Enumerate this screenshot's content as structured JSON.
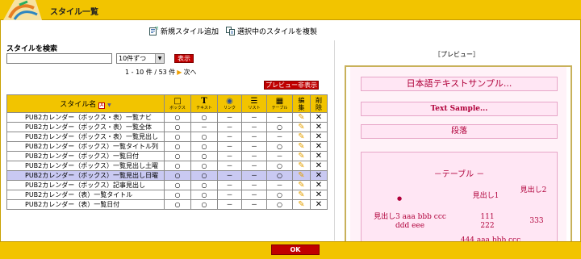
{
  "window": {
    "title": "スタイル一覧"
  },
  "toolbar": {
    "add_label": "新規スタイル追加",
    "copy_label": "選択中のスタイルを複製"
  },
  "search": {
    "label": "スタイルを検索",
    "value": "",
    "per_page": "10件ずつ",
    "show_label": "表示"
  },
  "pager": {
    "summary": "1 - 10 件 / 53 件",
    "next_label": "次へ"
  },
  "preview_toggle_label": "プレビュー非表示",
  "table": {
    "name_header": "スタイル名",
    "columns": [
      {
        "icon": "box-icon",
        "label": "ボックス"
      },
      {
        "icon": "text-icon",
        "label": "テキスト"
      },
      {
        "icon": "link-icon",
        "label": "リンク"
      },
      {
        "icon": "list-icon",
        "label": "リスト"
      },
      {
        "icon": "table-icon",
        "label": "テーブル"
      }
    ],
    "edit_header": "編集",
    "delete_header": "削除",
    "rows": [
      {
        "name": "PUB2カレンダー（ボックス・表）一覧ナビ",
        "cells": [
          "○",
          "○",
          "－",
          "－",
          "－"
        ],
        "selected": false
      },
      {
        "name": "PUB2カレンダー（ボックス・表）一覧全体",
        "cells": [
          "○",
          "－",
          "－",
          "－",
          "○"
        ],
        "selected": false
      },
      {
        "name": "PUB2カレンダー（ボックス・表）一覧見出し",
        "cells": [
          "○",
          "○",
          "－",
          "－",
          "－"
        ],
        "selected": false
      },
      {
        "name": "PUB2カレンダー（ボックス）一覧タイトル列",
        "cells": [
          "○",
          "○",
          "－",
          "－",
          "○"
        ],
        "selected": false
      },
      {
        "name": "PUB2カレンダー（ボックス）一覧日付",
        "cells": [
          "○",
          "○",
          "－",
          "－",
          "－"
        ],
        "selected": false
      },
      {
        "name": "PUB2カレンダー（ボックス）一覧見出し土曜",
        "cells": [
          "○",
          "○",
          "－",
          "－",
          "○"
        ],
        "selected": false
      },
      {
        "name": "PUB2カレンダー（ボックス）一覧見出し日曜",
        "cells": [
          "○",
          "○",
          "－",
          "－",
          "○"
        ],
        "selected": true
      },
      {
        "name": "PUB2カレンダー（ボックス）記事見出し",
        "cells": [
          "○",
          "○",
          "－",
          "－",
          "－"
        ],
        "selected": false
      },
      {
        "name": "PUB2カレンダー（表）一覧タイトル",
        "cells": [
          "○",
          "○",
          "－",
          "－",
          "○"
        ],
        "selected": false
      },
      {
        "name": "PUB2カレンダー（表）一覧日付",
        "cells": [
          "○",
          "○",
          "－",
          "－",
          "○"
        ],
        "selected": false
      }
    ]
  },
  "preview": {
    "title": "［プレビュー］",
    "japanese_sample": "日本語テキストサンプル...",
    "text_sample": "Text Sample...",
    "paragraph": "段落",
    "table_caption": "－テーブル －",
    "cells": {
      "bullet": "●",
      "heading1": "見出し1",
      "heading2": "見出し2",
      "heading3": "見出し3 aaa bbb ccc ddd eee",
      "value1": "111 222",
      "value2": "333",
      "value3": "444 aaa bbb ccc"
    }
  },
  "footer": {
    "ok_label": "OK"
  },
  "colors": {
    "header": "#f2c400",
    "accent": "#c00000",
    "selected_row": "#c9c9f2",
    "preview_text": "#b0003a"
  }
}
